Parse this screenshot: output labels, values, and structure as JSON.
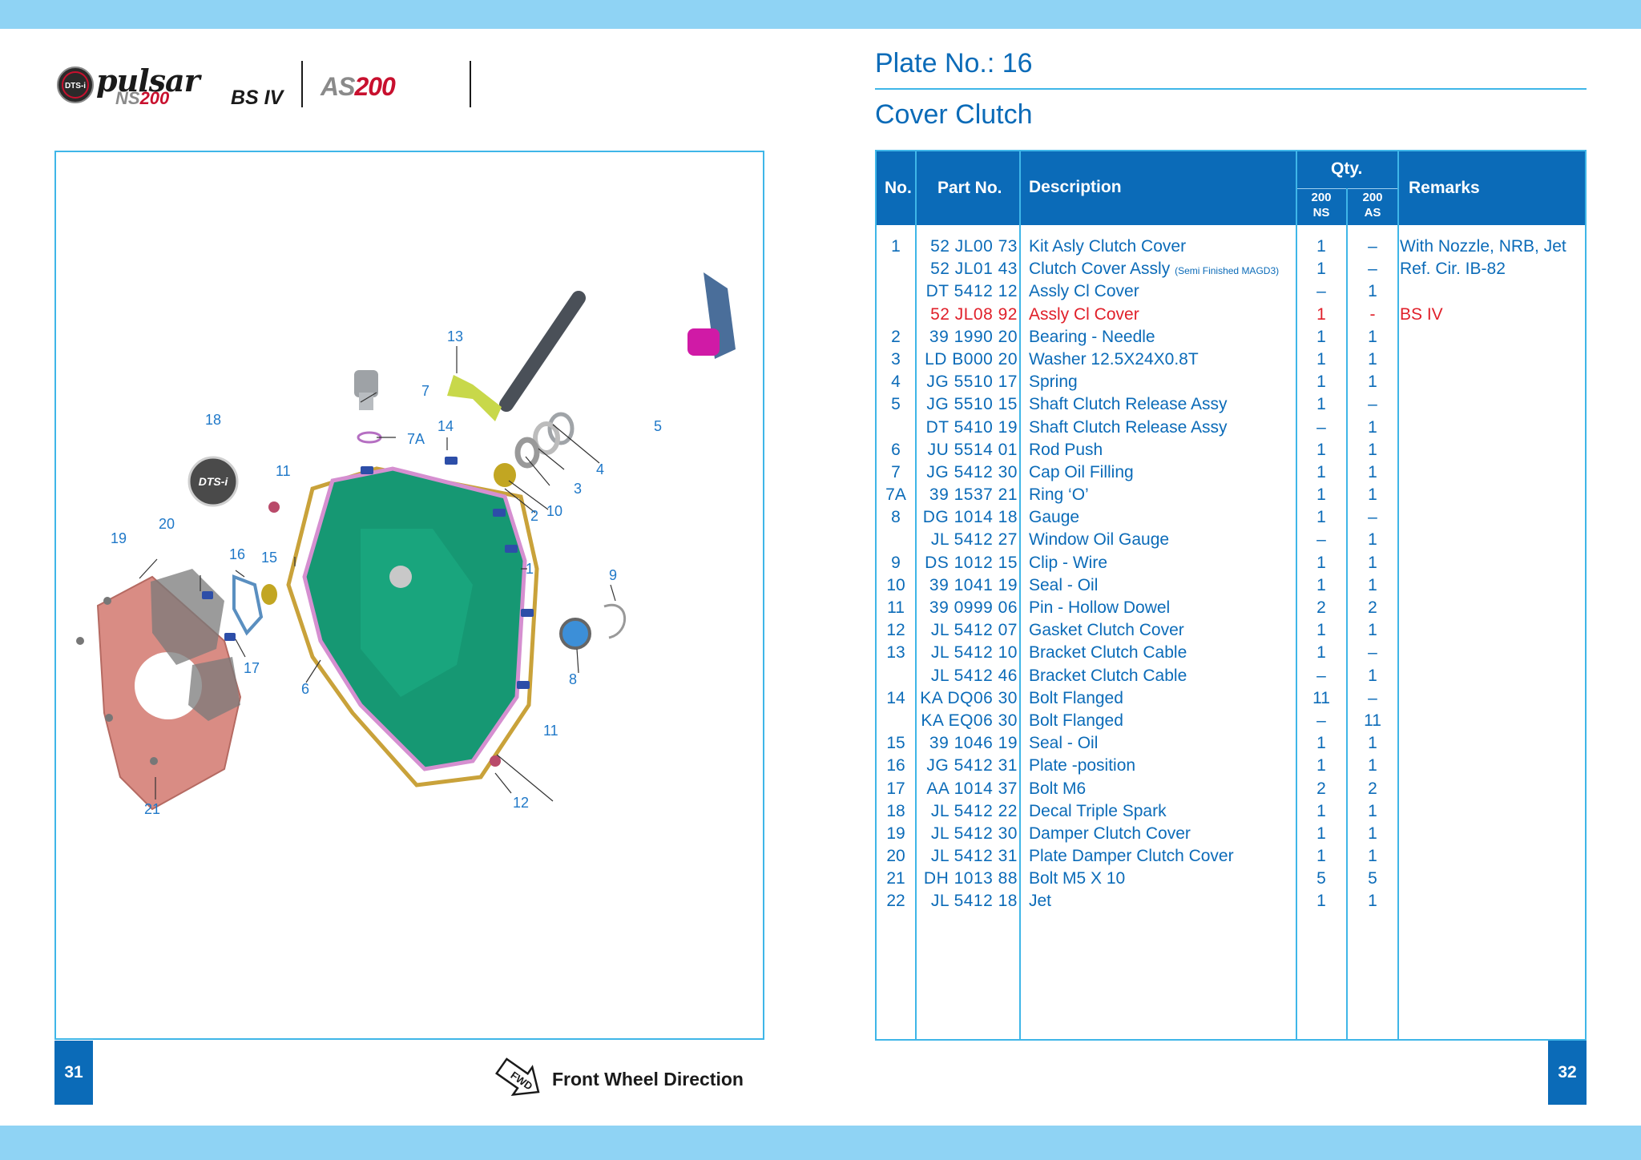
{
  "brand": {
    "logo_badge": "DTS-i",
    "model_script": "pulsar",
    "model_ns": "NS",
    "model_ns_num": "200",
    "emission": "BS IV",
    "model_as": "AS",
    "model_as_num": "200"
  },
  "left_page": {
    "page_number": "31",
    "direction_icon_label": "FWD",
    "direction_label": "Front Wheel Direction",
    "decal_text": "DTS-i",
    "callouts": [
      "1",
      "2",
      "3",
      "4",
      "5",
      "6",
      "7",
      "7A",
      "8",
      "9",
      "10",
      "11",
      "11",
      "12",
      "13",
      "14",
      "15",
      "16",
      "17",
      "18",
      "19",
      "20",
      "21"
    ]
  },
  "right_page": {
    "page_number": "32",
    "plate_no": "Plate No.: 16",
    "title": "Cover Clutch",
    "table": {
      "headers": {
        "no": "No.",
        "part_no": "Part No.",
        "description": "Description",
        "qty": "Qty.",
        "qty_ns": "200\nNS",
        "qty_as": "200\nAS",
        "remarks": "Remarks"
      },
      "rows": [
        {
          "no": "1",
          "part": "52 JL00 73",
          "desc": "Kit Asly Clutch Cover",
          "note": "",
          "ns": "1",
          "as": "–",
          "rem": "With Nozzle, NRB, Jet",
          "red": false
        },
        {
          "no": "",
          "part": "52 JL01 43",
          "desc": "Clutch Cover Assly",
          "note": "(Semi Finished MAGD3)",
          "ns": "1",
          "as": "–",
          "rem": "Ref. Cir. IB-82",
          "red": false
        },
        {
          "no": "",
          "part": "DT 5412 12",
          "desc": "Assly Cl Cover",
          "note": "",
          "ns": "–",
          "as": "1",
          "rem": "",
          "red": false
        },
        {
          "no": "",
          "part": "52 JL08 92",
          "desc": "Assly Cl Cover",
          "note": "",
          "ns": "1",
          "as": "-",
          "rem": "BS IV",
          "red": true
        },
        {
          "no": "2",
          "part": "39 1990 20",
          "desc": "Bearing - Needle",
          "note": "",
          "ns": "1",
          "as": "1",
          "rem": "",
          "red": false
        },
        {
          "no": "3",
          "part": "LD B000 20",
          "desc": "Washer 12.5X24X0.8T",
          "note": "",
          "ns": "1",
          "as": "1",
          "rem": "",
          "red": false
        },
        {
          "no": "4",
          "part": "JG 5510 17",
          "desc": "Spring",
          "note": "",
          "ns": "1",
          "as": "1",
          "rem": "",
          "red": false
        },
        {
          "no": "5",
          "part": "JG 5510 15",
          "desc": "Shaft Clutch Release Assy",
          "note": "",
          "ns": "1",
          "as": "–",
          "rem": "",
          "red": false
        },
        {
          "no": "",
          "part": "DT 5410 19",
          "desc": "Shaft Clutch Release Assy",
          "note": "",
          "ns": "–",
          "as": "1",
          "rem": "",
          "red": false
        },
        {
          "no": "6",
          "part": "JU 5514 01",
          "desc": "Rod Push",
          "note": "",
          "ns": "1",
          "as": "1",
          "rem": "",
          "red": false
        },
        {
          "no": "7",
          "part": "JG 5412 30",
          "desc": "Cap Oil Filling",
          "note": "",
          "ns": "1",
          "as": "1",
          "rem": "",
          "red": false
        },
        {
          "no": "7A",
          "part": "39 1537 21",
          "desc": "Ring ‘O’",
          "note": "",
          "ns": "1",
          "as": "1",
          "rem": "",
          "red": false
        },
        {
          "no": "8",
          "part": "DG 1014 18",
          "desc": "Gauge",
          "note": "",
          "ns": "1",
          "as": "–",
          "rem": "",
          "red": false
        },
        {
          "no": "",
          "part": "JL 5412 27",
          "desc": "Window Oil Gauge",
          "note": "",
          "ns": "–",
          "as": "1",
          "rem": "",
          "red": false
        },
        {
          "no": "9",
          "part": "DS 1012 15",
          "desc": "Clip - Wire",
          "note": "",
          "ns": "1",
          "as": "1",
          "rem": "",
          "red": false
        },
        {
          "no": "10",
          "part": "39 1041 19",
          "desc": "Seal - Oil",
          "note": "",
          "ns": "1",
          "as": "1",
          "rem": "",
          "red": false
        },
        {
          "no": "11",
          "part": "39 0999 06",
          "desc": "Pin - Hollow Dowel",
          "note": "",
          "ns": "2",
          "as": "2",
          "rem": "",
          "red": false
        },
        {
          "no": "12",
          "part": "JL 5412 07",
          "desc": "Gasket Clutch Cover",
          "note": "",
          "ns": "1",
          "as": "1",
          "rem": "",
          "red": false
        },
        {
          "no": "13",
          "part": "JL 5412 10",
          "desc": "Bracket Clutch Cable",
          "note": "",
          "ns": "1",
          "as": "–",
          "rem": "",
          "red": false
        },
        {
          "no": "",
          "part": "JL 5412 46",
          "desc": "Bracket Clutch Cable",
          "note": "",
          "ns": "–",
          "as": "1",
          "rem": "",
          "red": false
        },
        {
          "no": "14",
          "part": "KA DQ06 30",
          "desc": "Bolt Flanged",
          "note": "",
          "ns": "11",
          "as": "–",
          "rem": "",
          "red": false
        },
        {
          "no": "",
          "part": "KA EQ06 30",
          "desc": "Bolt Flanged",
          "note": "",
          "ns": "–",
          "as": "11",
          "rem": "",
          "red": false
        },
        {
          "no": "15",
          "part": "39 1046 19",
          "desc": "Seal - Oil",
          "note": "",
          "ns": "1",
          "as": "1",
          "rem": "",
          "red": false
        },
        {
          "no": "16",
          "part": "JG 5412 31",
          "desc": "Plate -position",
          "note": "",
          "ns": "1",
          "as": "1",
          "rem": "",
          "red": false
        },
        {
          "no": "17",
          "part": "AA 1014 37",
          "desc": "Bolt M6",
          "note": "",
          "ns": "2",
          "as": "2",
          "rem": "",
          "red": false
        },
        {
          "no": "18",
          "part": "JL 5412 22",
          "desc": "Decal Triple Spark",
          "note": "",
          "ns": "1",
          "as": "1",
          "rem": "",
          "red": false
        },
        {
          "no": "19",
          "part": "JL 5412 30",
          "desc": "Damper Clutch Cover",
          "note": "",
          "ns": "1",
          "as": "1",
          "rem": "",
          "red": false
        },
        {
          "no": "20",
          "part": "JL 5412 31",
          "desc": "Plate Damper Clutch Cover",
          "note": "",
          "ns": "1",
          "as": "1",
          "rem": "",
          "red": false
        },
        {
          "no": "21",
          "part": "DH 1013 88",
          "desc": "Bolt M5 X 10",
          "note": "",
          "ns": "5",
          "as": "5",
          "rem": "",
          "red": false
        },
        {
          "no": "22",
          "part": "JL 5412 18",
          "desc": "Jet",
          "note": "",
          "ns": "1",
          "as": "1",
          "rem": "",
          "red": false
        }
      ]
    }
  },
  "colors": {
    "band": "#8fd3f4",
    "accent_blue": "#0b6bb8",
    "frame_blue": "#3fb6e8",
    "highlight_red": "#e0202a",
    "cover_green": "#169873",
    "gasket_gold": "#c9a23a",
    "damper_pink": "#d98c84"
  }
}
